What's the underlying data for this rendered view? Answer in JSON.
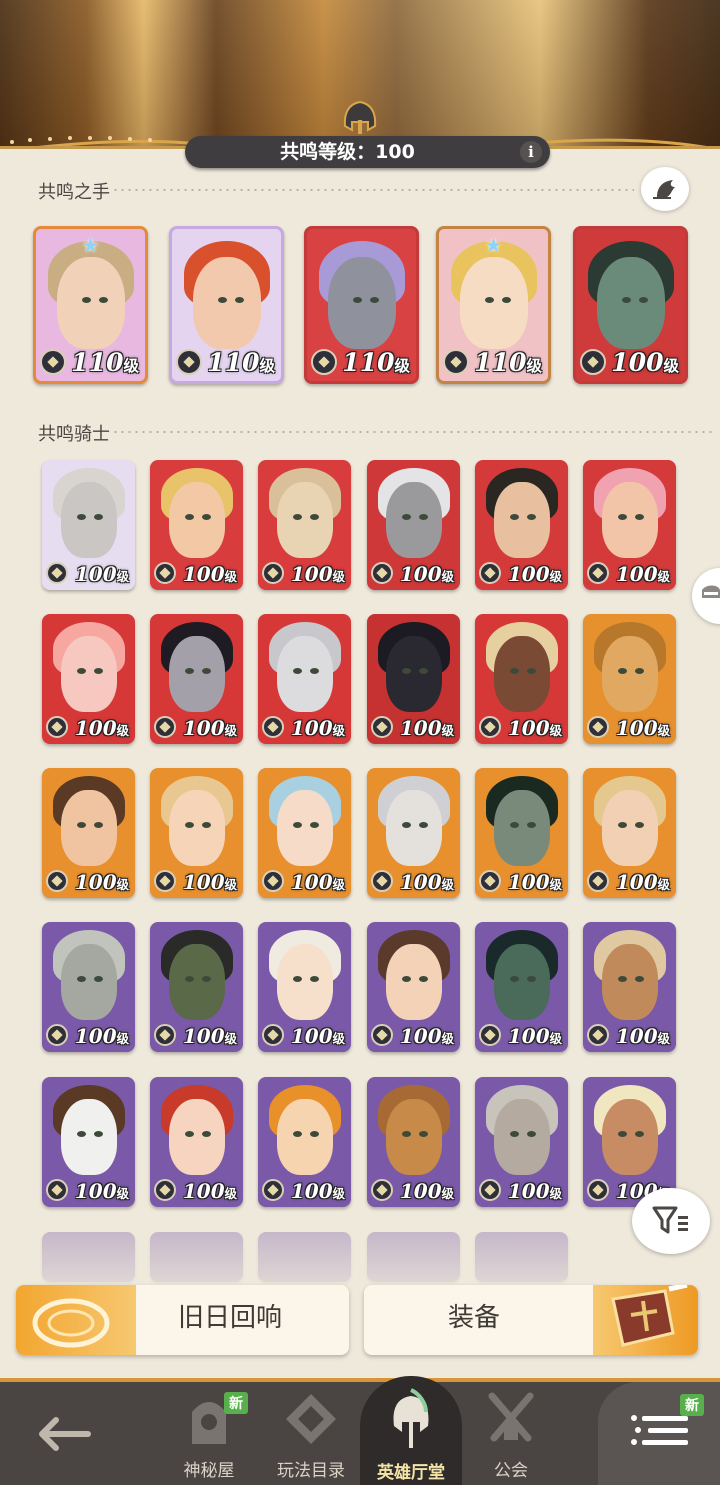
{
  "resonance": {
    "level_label": "共鸣等级：100",
    "info_label": "i"
  },
  "sections": {
    "hands_title": "共鸣之手",
    "knights_title": "共鸣骑士"
  },
  "hands": [
    {
      "name": "hero-1",
      "level": "110",
      "unit": "级",
      "starred": true,
      "bg": "#e8b8e0",
      "skin": "#f1d2b8",
      "hair": "#c9ae84",
      "frame": "#e58a3a"
    },
    {
      "name": "hero-2",
      "level": "110",
      "unit": "级",
      "starred": false,
      "bg": "#e4d4f0",
      "skin": "#f3c9ad",
      "hair": "#d8502c",
      "frame": "#c8a8e0"
    },
    {
      "name": "hero-3",
      "level": "110",
      "unit": "级",
      "starred": false,
      "bg": "#d84242",
      "skin": "#8f929c",
      "hair": "#a89ad6",
      "frame": "#c23a3a"
    },
    {
      "name": "hero-4",
      "level": "110",
      "unit": "级",
      "starred": true,
      "bg": "#f0c2c6",
      "skin": "#f7dcc4",
      "hair": "#e8c35e",
      "frame": "#c38445"
    },
    {
      "name": "hero-5",
      "level": "100",
      "unit": "级",
      "starred": false,
      "bg": "#cf3a3a",
      "skin": "#6a8a7a",
      "hair": "#2b3a32",
      "frame": "#c23a3a"
    }
  ],
  "knights": [
    {
      "level": "100",
      "unit": "级",
      "bg": "#e6ddf0",
      "skin": "#c9c6c4",
      "hair": "#d8d4d0"
    },
    {
      "level": "100",
      "unit": "级",
      "bg": "#d83c3c",
      "skin": "#f2c9a4",
      "hair": "#e8c36a"
    },
    {
      "level": "100",
      "unit": "级",
      "bg": "#d83c3c",
      "skin": "#e8d3b2",
      "hair": "#d9c09a"
    },
    {
      "level": "100",
      "unit": "级",
      "bg": "#cf3838",
      "skin": "#9a9a9c",
      "hair": "#e4e4e6"
    },
    {
      "level": "100",
      "unit": "级",
      "bg": "#d43a3a",
      "skin": "#e8c0a0",
      "hair": "#2a2622"
    },
    {
      "level": "100",
      "unit": "级",
      "bg": "#d43a3a",
      "skin": "#f2c4a8",
      "hair": "#f0a2b0"
    },
    {
      "level": "100",
      "unit": "级",
      "bg": "#d63838",
      "skin": "#f6c8c0",
      "hair": "#f6a8a0"
    },
    {
      "level": "100",
      "unit": "级",
      "bg": "#d63838",
      "skin": "#a4a0aa",
      "hair": "#1e1c22"
    },
    {
      "level": "100",
      "unit": "级",
      "bg": "#d63838",
      "skin": "#dcdcde",
      "hair": "#c8c8cc"
    },
    {
      "level": "100",
      "unit": "级",
      "bg": "#c63232",
      "skin": "#2a2830",
      "hair": "#1c1a22"
    },
    {
      "level": "100",
      "unit": "级",
      "bg": "#d63838",
      "skin": "#7a4a34",
      "hair": "#e6d0a0"
    },
    {
      "level": "100",
      "unit": "级",
      "bg": "#e7902e",
      "skin": "#e0a860",
      "hair": "#b8782c"
    },
    {
      "level": "100",
      "unit": "级",
      "bg": "#e8902e",
      "skin": "#f0c4a0",
      "hair": "#5a3a24"
    },
    {
      "level": "100",
      "unit": "级",
      "bg": "#e8902e",
      "skin": "#f6d4b8",
      "hair": "#e8c890"
    },
    {
      "level": "100",
      "unit": "级",
      "bg": "#e8902e",
      "skin": "#f6dcc8",
      "hair": "#a8d0e0"
    },
    {
      "level": "100",
      "unit": "级",
      "bg": "#e8902e",
      "skin": "#e4e0dc",
      "hair": "#d0d0d4"
    },
    {
      "level": "100",
      "unit": "级",
      "bg": "#e8902e",
      "skin": "#7a8a7a",
      "hair": "#1a2a20"
    },
    {
      "level": "100",
      "unit": "级",
      "bg": "#e8902e",
      "skin": "#f2d0b4",
      "hair": "#e4c88e"
    },
    {
      "level": "100",
      "unit": "级",
      "bg": "#7a5aa8",
      "skin": "#a4a8a0",
      "hair": "#c0c4bc"
    },
    {
      "level": "100",
      "unit": "级",
      "bg": "#7a5aa8",
      "skin": "#5a6a48",
      "hair": "#2a2a28"
    },
    {
      "level": "100",
      "unit": "级",
      "bg": "#7a5aa8",
      "skin": "#f6e0cc",
      "hair": "#f0ebe0"
    },
    {
      "level": "100",
      "unit": "级",
      "bg": "#7a5aa8",
      "skin": "#f4d2b8",
      "hair": "#5a3a2a"
    },
    {
      "level": "100",
      "unit": "级",
      "bg": "#7a5aa8",
      "skin": "#4a6a5a",
      "hair": "#1a2a2a"
    },
    {
      "level": "100",
      "unit": "级",
      "bg": "#7a5aa8",
      "skin": "#c08a5a",
      "hair": "#e0c8a0"
    },
    {
      "level": "100",
      "unit": "级",
      "bg": "#7a5aa8",
      "skin": "#f0f0ee",
      "hair": "#5a3a24"
    },
    {
      "level": "100",
      "unit": "级",
      "bg": "#7a5aa8",
      "skin": "#f6d4c0",
      "hair": "#c83a2a"
    },
    {
      "level": "100",
      "unit": "级",
      "bg": "#7a5aa8",
      "skin": "#f6d4b0",
      "hair": "#e8902a"
    },
    {
      "level": "100",
      "unit": "级",
      "bg": "#7a5aa8",
      "skin": "#c88a48",
      "hair": "#a86a34"
    },
    {
      "level": "100",
      "unit": "级",
      "bg": "#7a5aa8",
      "skin": "#b4aaa0",
      "hair": "#c8c4bc"
    },
    {
      "level": "100",
      "unit": "级",
      "bg": "#7a5aa8",
      "skin": "#c88c64",
      "hair": "#f0e6c0"
    }
  ],
  "buttons": {
    "echo_label": "旧日回响",
    "equip_label": "装备"
  },
  "nav": {
    "back_icon": "back-arrow-icon",
    "items": [
      {
        "label": "神秘屋",
        "icon": "mystery-house-icon",
        "badge": "新"
      },
      {
        "label": "玩法目录",
        "icon": "catalog-icon",
        "badge": ""
      },
      {
        "label": "英雄厅堂",
        "icon": "hero-hall-icon",
        "badge": ""
      },
      {
        "label": "公会",
        "icon": "guild-icon",
        "badge": ""
      }
    ],
    "menu_badge": "新"
  },
  "colors": {
    "accent": "#d79536",
    "panel": "#efe9dc",
    "nav_bg": "#4a4543"
  }
}
